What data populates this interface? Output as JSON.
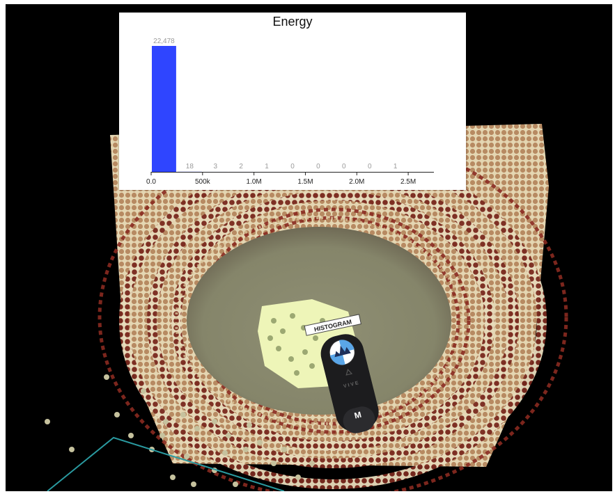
{
  "histogram": {
    "title": "Energy",
    "chart_data": {
      "type": "bar",
      "title": "Energy",
      "bin_width": 250000,
      "bin_starts": [
        0,
        250000,
        500000,
        750000,
        1000000,
        1250000,
        1500000,
        1750000,
        2000000,
        2250000,
        2500000,
        2750000
      ],
      "counts": [
        22478,
        18,
        3,
        2,
        1,
        0,
        0,
        0,
        0,
        1
      ],
      "count_labels": [
        "22,478",
        "18",
        "3",
        "2",
        "1",
        "0",
        "0",
        "0",
        "0",
        "1"
      ],
      "tick_values": [
        0,
        500000,
        1000000,
        1500000,
        2000000,
        2500000
      ],
      "tick_labels": [
        "0.0",
        "500k",
        "1.0M",
        "1.5M",
        "2.0M",
        "2.5M"
      ],
      "xlim": [
        0,
        2750000
      ],
      "ylim": [
        0,
        22478
      ],
      "bar_color": "#2f45ff",
      "grid": false
    }
  },
  "controller": {
    "tooltip_label": "HISTOGRAM",
    "logo_text": "VIVE",
    "menu_button_label": "M",
    "icon": "histogram-icon"
  },
  "scene": {
    "background": "#000000",
    "floor_color": "#8a8a6e",
    "point_colors": [
      "#e8d8b0",
      "#c9a07a",
      "#9c4a32",
      "#6e1a1a",
      "#b06a3a"
    ],
    "selection_color": "#eef5b8",
    "grid_line_color": "#2a9aa0"
  }
}
